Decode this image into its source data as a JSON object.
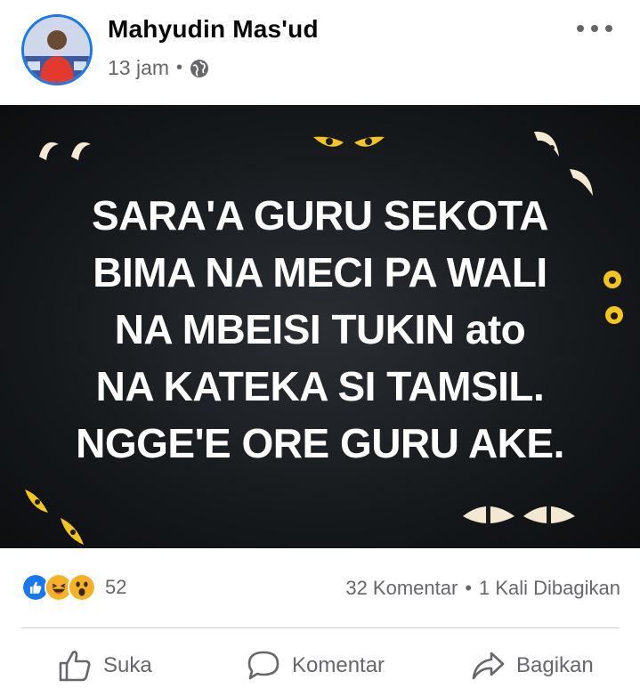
{
  "post": {
    "author": "Mahyudin Mas'ud",
    "time": "13 jam",
    "separator": "•",
    "privacy_icon": "globe-icon"
  },
  "image": {
    "lines": [
      "SARA'A GURU SEKOTA",
      "BIMA NA MECI PA WALI",
      "NA MBEISI TUKIN ato",
      "NA KATEKA SI TAMSIL.",
      "NGGE'E ORE GURU AKE."
    ]
  },
  "stats": {
    "reactions": [
      "like-icon",
      "haha-icon",
      "wow-icon"
    ],
    "reaction_count": "52",
    "comments": "32 Komentar",
    "dot": "•",
    "shares": "1 Kali Dibagikan"
  },
  "actions": {
    "like_label": "Suka",
    "comment_label": "Komentar",
    "share_label": "Bagikan"
  },
  "colors": {
    "accent": "#1877f2",
    "muted": "#65676b",
    "image_bg": "#16191c",
    "eyes": "#f5c518"
  }
}
